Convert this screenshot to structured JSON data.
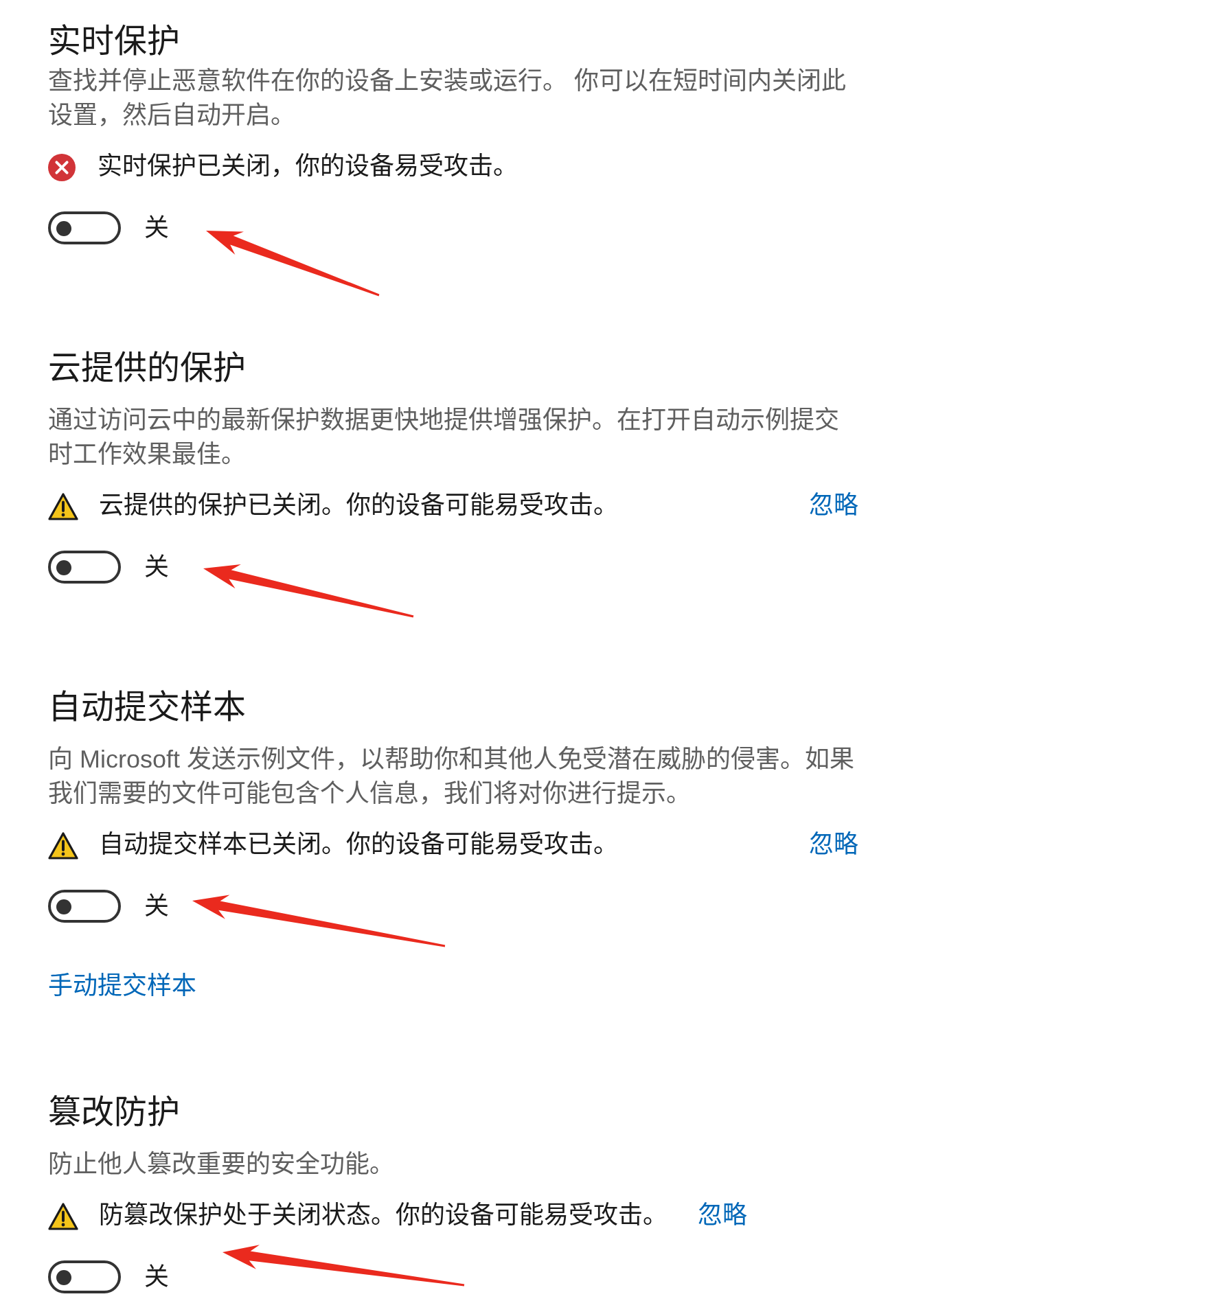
{
  "sections": [
    {
      "title": "实时保护",
      "description": "查找并停止恶意软件在你的设备上安装或运行。 你可以在短时间内关闭此设置，然后自动开启。",
      "status": {
        "kind": "error",
        "text": "实时保护已关闭，你的设备易受攻击。"
      },
      "toggle": {
        "on": false,
        "label": "关"
      }
    },
    {
      "title": "云提供的保护",
      "description": "通过访问云中的最新保护数据更快地提供增强保护。在打开自动示例提交时工作效果最佳。",
      "status": {
        "kind": "warning",
        "text": "云提供的保护已关闭。你的设备可能易受攻击。",
        "action": "忽略"
      },
      "toggle": {
        "on": false,
        "label": "关"
      }
    },
    {
      "title": "自动提交样本",
      "description": "向 Microsoft 发送示例文件，以帮助你和其他人免受潜在威胁的侵害。如果我们需要的文件可能包含个人信息，我们将对你进行提示。",
      "status": {
        "kind": "warning",
        "text": "自动提交样本已关闭。你的设备可能易受攻击。",
        "action": "忽略"
      },
      "toggle": {
        "on": false,
        "label": "关"
      },
      "link": "手动提交样本"
    },
    {
      "title": "篡改防护",
      "description": "防止他人篡改重要的安全功能。",
      "status": {
        "kind": "warning",
        "text": "防篡改保护处于关闭状态。你的设备可能易受攻击。",
        "action": "忽略"
      },
      "toggle": {
        "on": false,
        "label": "关"
      }
    }
  ]
}
